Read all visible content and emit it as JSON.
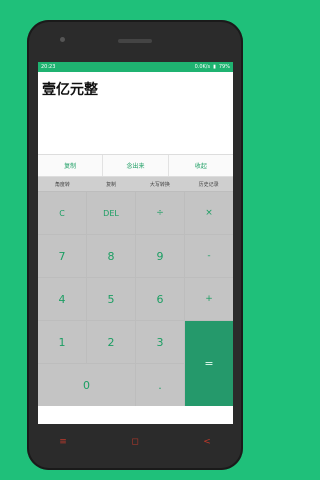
{
  "status": {
    "time": "20:23",
    "right_text": "0.0K/s",
    "battery": "79%"
  },
  "display": {
    "result": "壹亿元整"
  },
  "actions": [
    {
      "label": "复制"
    },
    {
      "label": "念出来"
    },
    {
      "label": "收起"
    }
  ],
  "functions": [
    {
      "label": "角度转"
    },
    {
      "label": "复制"
    },
    {
      "label": "大写转换"
    },
    {
      "label": "历史记录"
    }
  ],
  "keys": {
    "c": "C",
    "del": "DEL",
    "divide": "÷",
    "multiply": "×",
    "seven": "7",
    "eight": "8",
    "nine": "9",
    "minus": "-",
    "four": "4",
    "five": "5",
    "six": "6",
    "plus": "+",
    "one": "1",
    "two": "2",
    "three": "3",
    "zero": "0",
    "dot": ".",
    "equals": "="
  },
  "nav": {
    "menu": "≡",
    "home": "◻",
    "back": "<"
  },
  "colors": {
    "background": "#1fc07a",
    "accent": "#25996b",
    "key_text": "#1c9e63"
  }
}
